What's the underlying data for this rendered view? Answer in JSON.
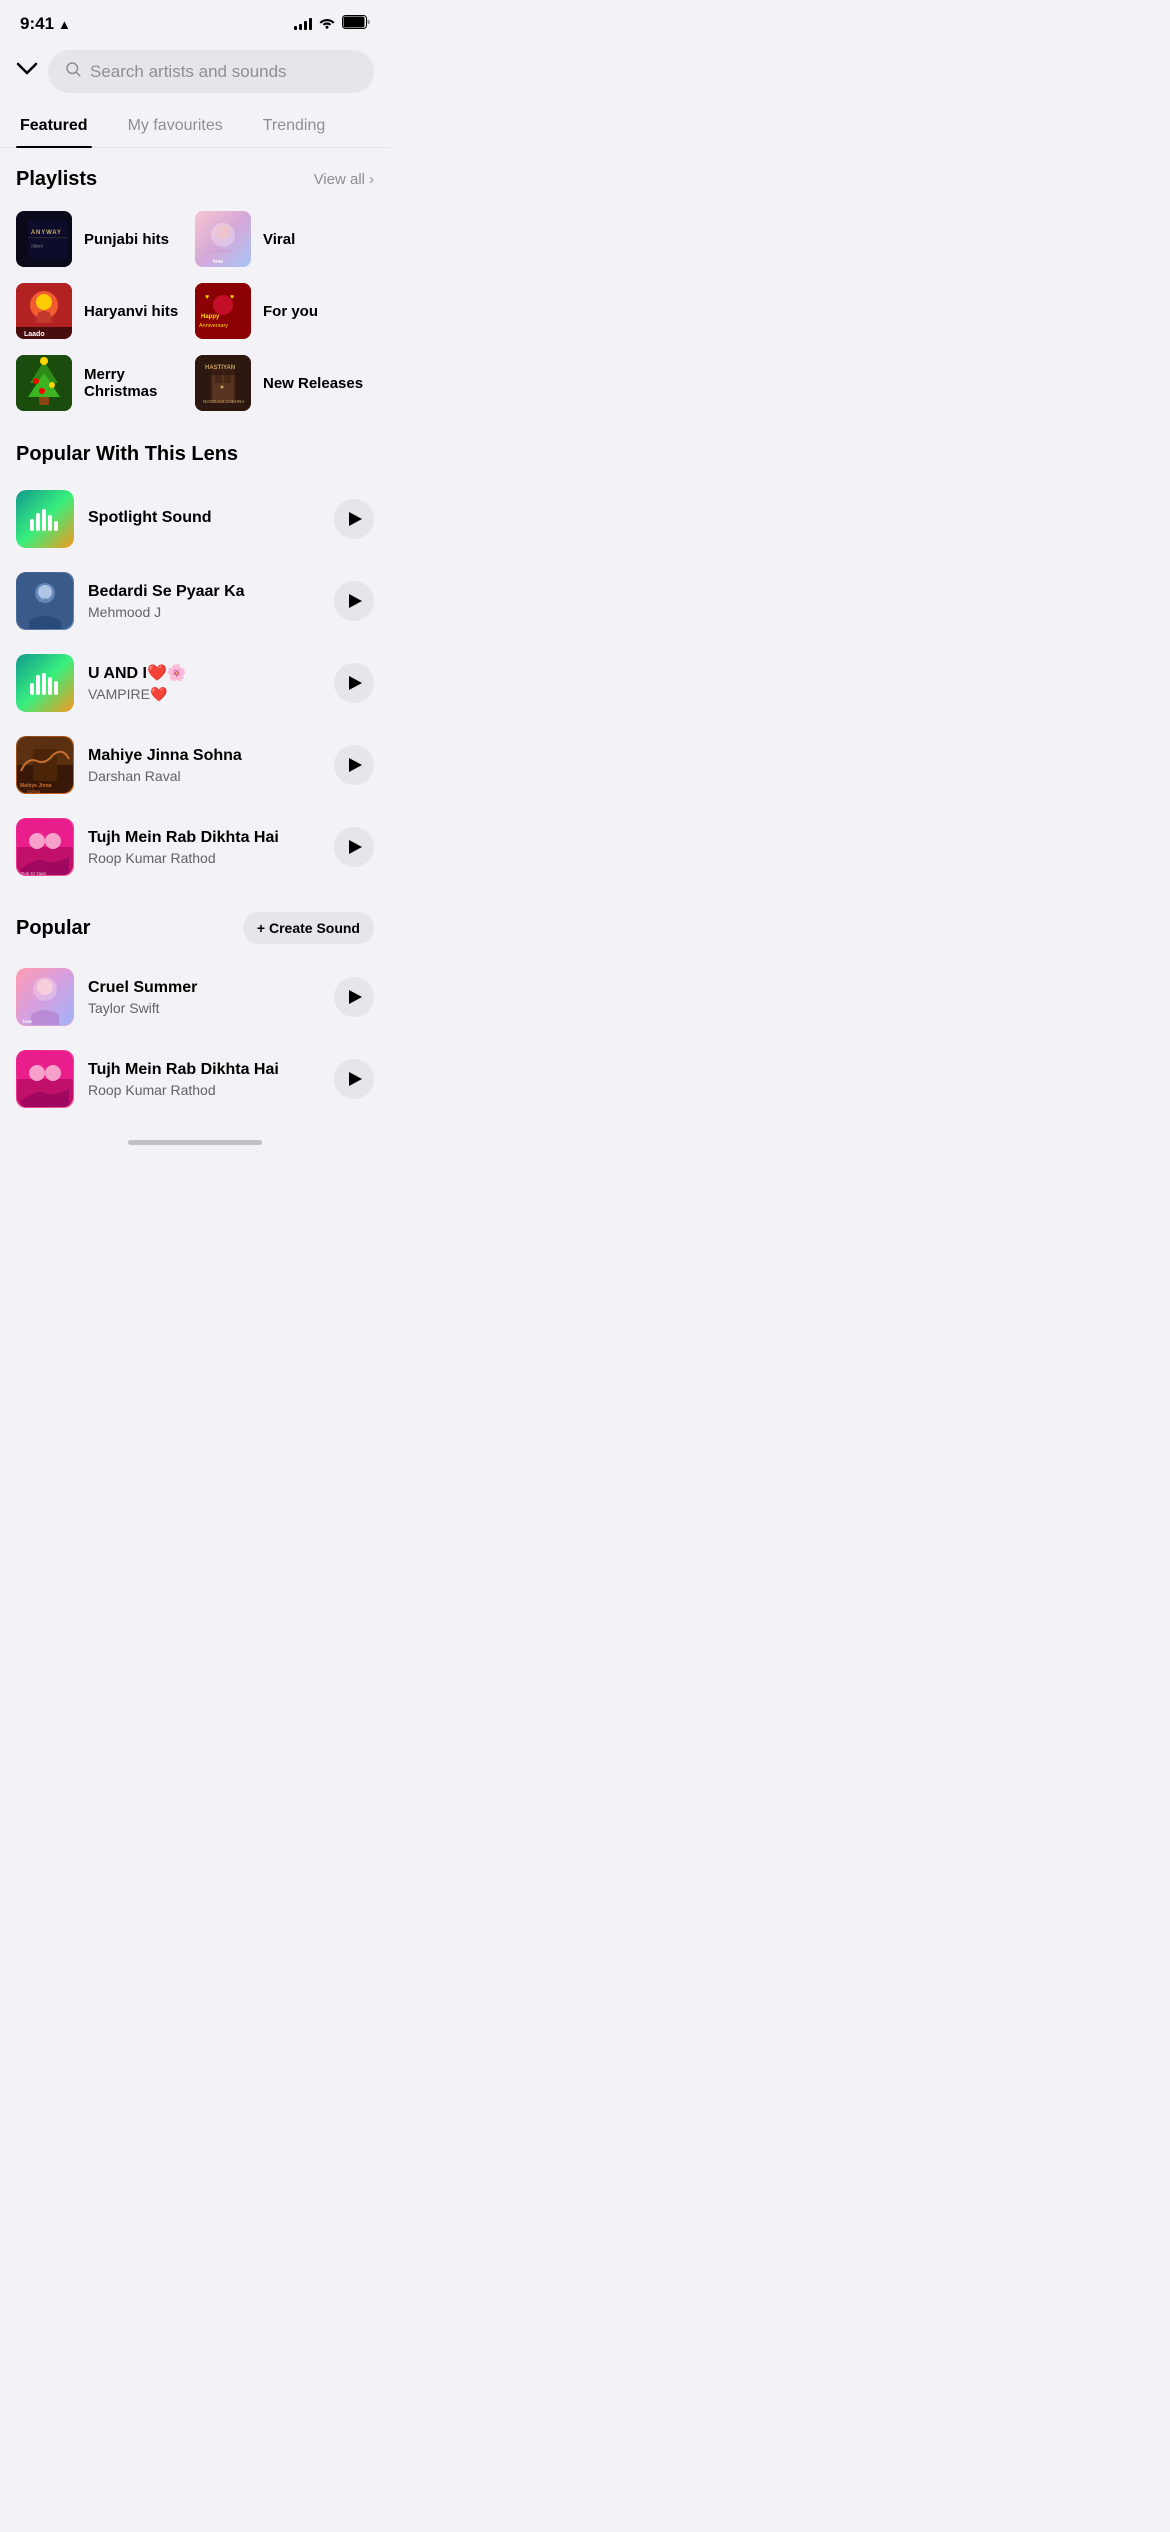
{
  "status": {
    "time": "9:41",
    "location_icon": "▲"
  },
  "search": {
    "placeholder": "Search artists and sounds",
    "down_arrow": "⌄"
  },
  "tabs": [
    {
      "id": "featured",
      "label": "Featured",
      "active": true
    },
    {
      "id": "my-favourites",
      "label": "My favourites",
      "active": false
    },
    {
      "id": "trending",
      "label": "Trending",
      "active": false
    }
  ],
  "playlists": {
    "section_title": "Playlists",
    "view_all": "View all",
    "items": [
      {
        "id": "punjabi-hits",
        "name": "Punjabi hits"
      },
      {
        "id": "viral",
        "name": "Viral"
      },
      {
        "id": "haryanvi-hits",
        "name": "Haryanvi hits"
      },
      {
        "id": "for-you",
        "name": "For you"
      },
      {
        "id": "merry-christmas",
        "name": "Merry Christmas"
      },
      {
        "id": "new-releases",
        "name": "New Releases"
      }
    ]
  },
  "popular_lens": {
    "section_title": "Popular With This Lens",
    "items": [
      {
        "id": "spotlight-sound",
        "title": "Spotlight Sound",
        "artist": "",
        "has_gradient": true
      },
      {
        "id": "bedardi-se-pyaar",
        "title": "Bedardi Se Pyaar Ka",
        "artist": "Mehmood J",
        "has_gradient": false
      },
      {
        "id": "u-and-i",
        "title": "U AND I❤️🌸",
        "artist": "VAMPIRE❤️",
        "has_gradient": true
      },
      {
        "id": "mahiye-jinna-sohna",
        "title": "Mahiye Jinna Sohna",
        "artist": "Darshan Raval",
        "has_gradient": false
      },
      {
        "id": "tujh-mein-rab",
        "title": "Tujh Mein Rab Dikhta Hai",
        "artist": "Roop Kumar Rathod",
        "has_gradient": false
      }
    ]
  },
  "popular": {
    "section_title": "Popular",
    "create_sound_label": "+ Create Sound",
    "items": [
      {
        "id": "cruel-summer",
        "title": "Cruel Summer",
        "artist": "Taylor Swift",
        "has_gradient": false
      },
      {
        "id": "tujh-mein-rab-2",
        "title": "Tujh Mein Rab Dikhta Hai",
        "artist": "Roop Kumar Rathod",
        "has_gradient": false
      }
    ]
  }
}
